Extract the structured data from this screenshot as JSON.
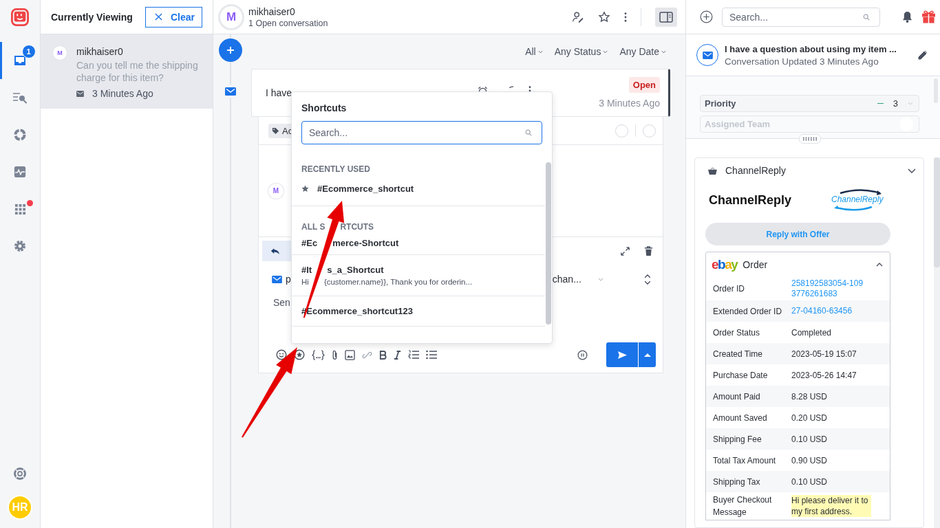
{
  "rail": {
    "items": [
      {
        "kind": "inbox",
        "selected": true,
        "badge": "1",
        "alert": false
      },
      {
        "kind": "search",
        "selected": false,
        "alert": false
      },
      {
        "kind": "reports",
        "selected": false,
        "alert": false
      },
      {
        "kind": "activity",
        "selected": false,
        "alert": false
      },
      {
        "kind": "apps",
        "selected": false,
        "alert": true
      },
      {
        "kind": "settings",
        "selected": false,
        "alert": false
      }
    ],
    "avatar": "HR"
  },
  "list_panel": {
    "title": "Currently Viewing",
    "clear_button": "Clear",
    "conversations": [
      {
        "avatar": "M",
        "name": "mikhaiser0",
        "preview": "Can you tell me the shipping charge for this item?",
        "time": "3 Minutes Ago",
        "selected": true
      }
    ]
  },
  "conversation_header": {
    "avatar": "M",
    "name": "mikhaiser0",
    "subtitle": "1 Open conversation"
  },
  "filters": [
    "All",
    "Any Status",
    "Any Date"
  ],
  "message": {
    "text": "I have",
    "status": "Open",
    "time": "3 Minutes Ago"
  },
  "composer": {
    "tag": "Ac",
    "avatar": "M",
    "from": "p",
    "channel": "chan...",
    "body": "Sen"
  },
  "shortcuts_popup": {
    "title": "Shortcuts",
    "search_placeholder": "Search...",
    "sections": [
      {
        "kind": "recent",
        "heading": [
          "RECENTLY USED"
        ],
        "items": [
          {
            "name": [
              "#Ecommerce_shortcut"
            ]
          }
        ]
      },
      {
        "kind": "all",
        "heading": [
          "ALL S",
          "RTCUTS"
        ],
        "items": [
          {
            "name": [
              "#Ec",
              "merce-Shortcut"
            ]
          },
          {
            "name": [
              "#It",
              "s_a_Shortcut"
            ],
            "preview": [
              "Hi",
              "{customer.name}}, Thank you for orderin..."
            ]
          },
          {
            "name": [
              "#Ecommerce_shortcut123"
            ]
          }
        ]
      }
    ]
  },
  "right_panel": {
    "search_placeholder": "Search...",
    "conversation": {
      "title": "I have a question about using my item ...",
      "subtitle": "Conversation Updated 3 Minutes Ago"
    },
    "properties": [
      {
        "label": "Priority",
        "value": "3",
        "disabled": false
      },
      {
        "label": "Assigned Team",
        "disabled": true
      }
    ],
    "widget": {
      "app": "ChannelReply",
      "heading": "ChannelReply",
      "logo": "ChannelReply",
      "button": "Reply with Offer",
      "order": {
        "marketplace": "ebay",
        "title": "Order",
        "rows": [
          {
            "label": "Order ID",
            "value": "258192583054-1093776261683",
            "kind": "link"
          },
          {
            "label": "Extended Order ID",
            "value": "27-04160-63456",
            "kind": "link"
          },
          {
            "label": "Order Status",
            "value": "Completed",
            "kind": "text"
          },
          {
            "label": "Created Time",
            "value": "2023-05-19 15:07",
            "kind": "text"
          },
          {
            "label": "Purchase Date",
            "value": "2023-05-26 14:47",
            "kind": "text"
          },
          {
            "label": "Amount Paid",
            "value": "8.28 USD",
            "kind": "text"
          },
          {
            "label": "Amount Saved",
            "value": "0.20 USD",
            "kind": "text"
          },
          {
            "label": "Shipping Fee",
            "value": "0.10 USD",
            "kind": "text"
          },
          {
            "label": "Total Tax Amount",
            "value": "0.90 USD",
            "kind": "text"
          },
          {
            "label": "Shipping Tax",
            "value": "0.10 USD",
            "kind": "text"
          },
          {
            "label": "Buyer Checkout Message",
            "value": "Hi please deliver it to my first address.",
            "kind": "highlight"
          }
        ]
      }
    }
  }
}
